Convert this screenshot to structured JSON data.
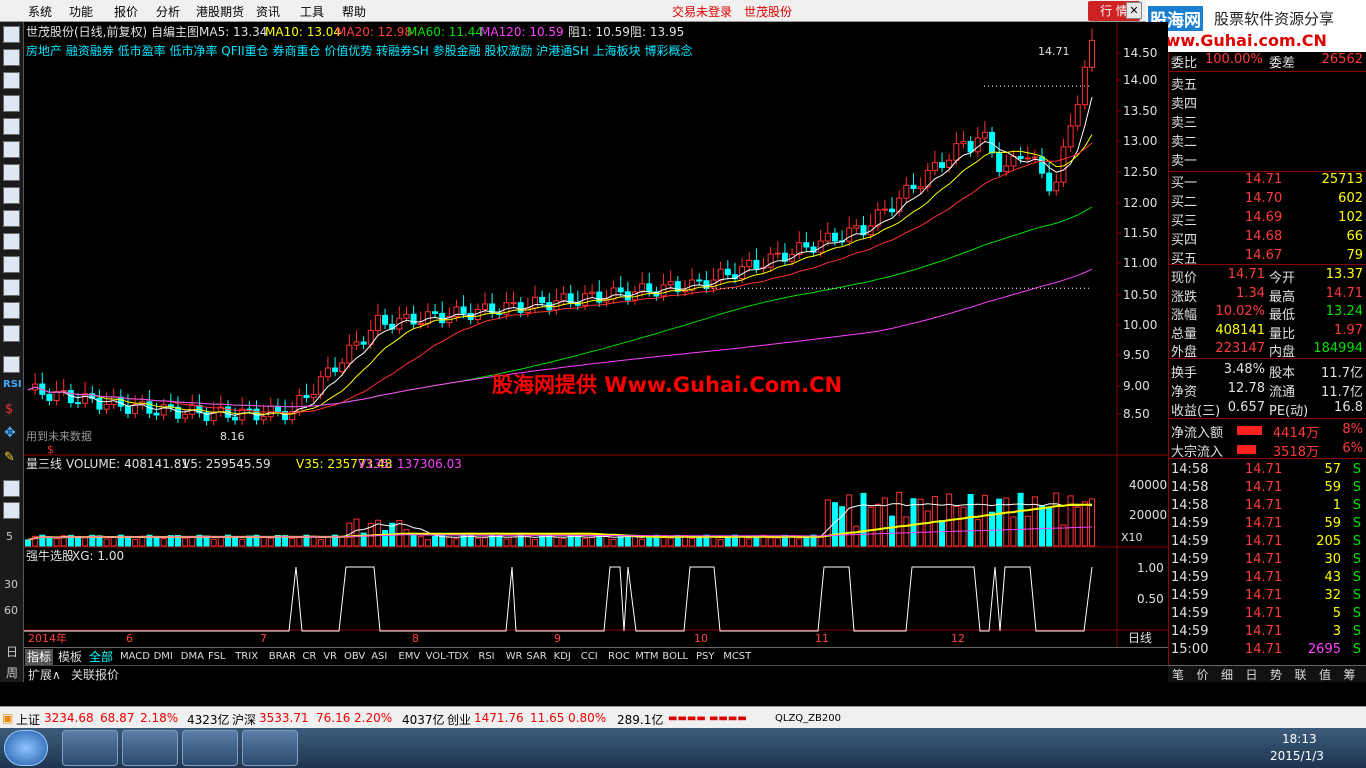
{
  "menubar": {
    "items": [
      "系统",
      "功能",
      "报价",
      "分析",
      "港股期货",
      "资讯",
      "工具",
      "帮助"
    ],
    "login_status": "交易未登录",
    "stock_name": "世茂股份",
    "quote_button": "行 情"
  },
  "logo": {
    "brand": "股海网",
    "tagline": "股票软件资源分享",
    "url": "Www.Guhai.com.CN"
  },
  "main_chart": {
    "title": "世茂股份(日线,前复权) 自编主图",
    "ma5": "MA5: 13.34",
    "ma10": "MA10: 13.04",
    "ma20": "MA20: 12.98",
    "ma60": "MA60: 11.44",
    "ma120": "MA120: 10.59",
    "resist1": "阻1: 10.59",
    "resist": "阻: 13.95",
    "concepts": "房地产 融资融券 低市盈率 低市净率 QFII重仓 券商重仓 价值优势 转融券SH 参股金融 股权激励 沪港通SH 上海板块 博彩概念",
    "high_label": "14.71",
    "low_label": "8.16",
    "note": "用到未来数据",
    "dollar": "$",
    "watermark": "股海网提供 Www.Guhai.Com.CN",
    "y_ticks": [
      "14.50",
      "14.00",
      "13.50",
      "13.00",
      "12.50",
      "12.00",
      "11.50",
      "11.00",
      "10.50",
      "10.00",
      "9.50",
      "9.00",
      "8.50"
    ]
  },
  "volume_panel": {
    "title": "量三线",
    "volume": "VOLUME: 408141.81",
    "v5": "V5: 259545.59",
    "v35": "V35: 235773.48",
    "v135": "V135: 137306.03",
    "y_ticks": [
      "40000",
      "20000"
    ],
    "unit": "X10"
  },
  "signal_panel": {
    "title": "强牛选股",
    "xg": "XG: 1.00",
    "y_ticks": [
      "1.00",
      "0.50"
    ],
    "left_ticks": [
      "5",
      "30",
      "60"
    ]
  },
  "x_axis": {
    "labels": [
      "2014年",
      "6",
      "7",
      "8",
      "9",
      "10",
      "11",
      "12"
    ],
    "period": "日线",
    "plus": "+",
    "minus": "-"
  },
  "indicator_tabs": [
    "指标",
    "模板",
    "全部",
    "MACD",
    "DMI",
    "DMA",
    "FSL",
    "TRIX",
    "BRAR",
    "CR",
    "VR",
    "OBV",
    "ASI",
    "EMV",
    "VOL-TDX",
    "RSI",
    "WR",
    "SAR",
    "KDJ",
    "CCI",
    "ROC",
    "MTM",
    "BOLL",
    "PSY",
    "MCST"
  ],
  "ext_tabs": [
    "扩展∧",
    "关联报价"
  ],
  "left_period": [
    "日",
    "周"
  ],
  "order_book": {
    "weibi_label": "委比",
    "weibi": "100.00%",
    "weicha_label": "委差",
    "weicha": "26562",
    "asks": [
      "卖五",
      "卖四",
      "卖三",
      "卖二",
      "卖一"
    ],
    "bids": [
      {
        "label": "买一",
        "price": "14.71",
        "vol": "25713"
      },
      {
        "label": "买二",
        "price": "14.70",
        "vol": "602"
      },
      {
        "label": "买三",
        "price": "14.69",
        "vol": "102"
      },
      {
        "label": "买四",
        "price": "14.68",
        "vol": "66"
      },
      {
        "label": "买五",
        "price": "14.67",
        "vol": "79"
      }
    ]
  },
  "quote_stats": [
    {
      "l1": "现价",
      "v1": "14.71",
      "l2": "今开",
      "v2": "13.37"
    },
    {
      "l1": "涨跌",
      "v1": "1.34",
      "l2": "最高",
      "v2": "14.71"
    },
    {
      "l1": "涨幅",
      "v1": "10.02%",
      "l2": "最低",
      "v2": "13.24"
    },
    {
      "l1": "总量",
      "v1": "408141",
      "l2": "量比",
      "v2": "1.97"
    },
    {
      "l1": "外盘",
      "v1": "223147",
      "l2": "内盘",
      "v2": "184994"
    }
  ],
  "fundamentals": [
    {
      "l1": "换手",
      "v1": "3.48%",
      "l2": "股本",
      "v2": "11.7亿"
    },
    {
      "l1": "净资",
      "v1": "12.78",
      "l2": "流通",
      "v2": "11.7亿"
    },
    {
      "l1": "收益(三)",
      "v1": "0.657",
      "l2": "PE(动)",
      "v2": "16.8"
    }
  ],
  "flows": [
    {
      "label": "净流入额",
      "value": "4414万",
      "pct": "8%",
      "bar": 0.45
    },
    {
      "label": "大宗流入",
      "value": "3518万",
      "pct": "6%",
      "bar": 0.35
    }
  ],
  "ticks": [
    {
      "t": "14:58",
      "p": "14.71",
      "v": "57",
      "s": "S"
    },
    {
      "t": "14:58",
      "p": "14.71",
      "v": "59",
      "s": "S"
    },
    {
      "t": "14:58",
      "p": "14.71",
      "v": "1",
      "s": "S"
    },
    {
      "t": "14:59",
      "p": "14.71",
      "v": "59",
      "s": "S"
    },
    {
      "t": "14:59",
      "p": "14.71",
      "v": "205",
      "s": "S"
    },
    {
      "t": "14:59",
      "p": "14.71",
      "v": "30",
      "s": "S"
    },
    {
      "t": "14:59",
      "p": "14.71",
      "v": "43",
      "s": "S"
    },
    {
      "t": "14:59",
      "p": "14.71",
      "v": "32",
      "s": "S"
    },
    {
      "t": "14:59",
      "p": "14.71",
      "v": "5",
      "s": "S"
    },
    {
      "t": "14:59",
      "p": "14.71",
      "v": "3",
      "s": "S"
    },
    {
      "t": "15:00",
      "p": "14.71",
      "v": "2695",
      "s": "S"
    }
  ],
  "right_tabs": [
    "笔",
    "价",
    "细",
    "日",
    "势",
    "联",
    "值",
    "筹"
  ],
  "status": {
    "sh_name": "上证",
    "sh_val": "3234.68",
    "sh_chg": "68.87",
    "sh_pct": "2.18%",
    "sh_amt": "4323亿",
    "sz_name": "沪深",
    "sz_val": "3533.71",
    "sz_chg": "76.16",
    "sz_pct": "2.20%",
    "sz_amt": "4037亿",
    "cy_name": "创业",
    "cy_val": "1471.76",
    "cy_chg": "11.65",
    "cy_pct": "0.80%",
    "cy_amt": "289.1亿",
    "server": "QLZQ_ZB200"
  },
  "taskbar": {
    "time": "18:13",
    "date": "2015/1/3"
  }
}
